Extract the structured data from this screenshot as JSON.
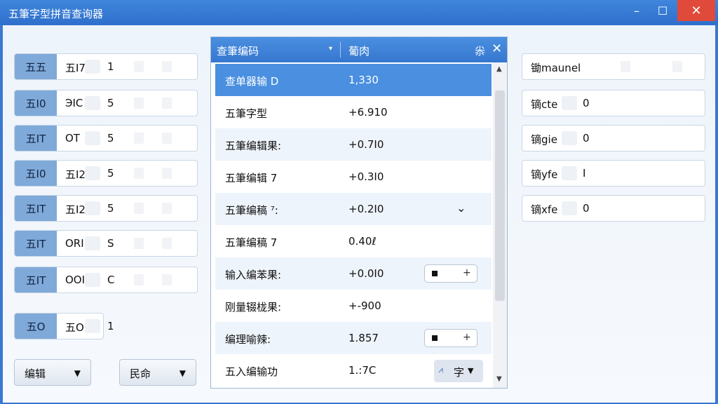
{
  "window": {
    "title": "五筆字型拼音查询器",
    "minimize": "–",
    "maximize": "☐",
    "close": "✕"
  },
  "left_rows": [
    {
      "tag": "五五",
      "code": "五I7",
      "value": "1"
    },
    {
      "tag": "五I0",
      "code": "ЭIC",
      "value": "5"
    },
    {
      "tag": "五IT",
      "code": "OT",
      "value": "5"
    },
    {
      "tag": "五I0",
      "code": "五I2",
      "value": "5"
    },
    {
      "tag": "五IT",
      "code": "五I2",
      "value": "5"
    },
    {
      "tag": "五IT",
      "code": "ORI",
      "value": "S"
    },
    {
      "tag": "五IT",
      "code": "OOIV",
      "value": "C"
    },
    {
      "tag": "五O",
      "code": "五OI",
      "value": "1"
    }
  ],
  "left_buttons": [
    {
      "label": "编辑",
      "arrow": "▼"
    },
    {
      "label": "民命",
      "arrow": "▼"
    }
  ],
  "grid": {
    "header_col1": "查筆编码",
    "header_col1_arrow": "▾",
    "header_col2": "葡肉",
    "header_icon": "尜",
    "header_close": "✕",
    "rows": [
      {
        "key": "查单器输 D",
        "value": "1,330",
        "selected": true
      },
      {
        "key": "五筆字型",
        "value": "+6.910",
        "alt": false
      },
      {
        "key": "五筆编辑果:",
        "value": "+0.7I0",
        "alt": true
      },
      {
        "key": "五筆编辑 7",
        "value": "+0.3I0",
        "alt": false
      },
      {
        "key": "五筆编稿 ⁷:",
        "value": "+0.2I0",
        "alt": true
      },
      {
        "key": "五筆编稿 7",
        "value": "0.40ℓ",
        "alt": false
      },
      {
        "key": "输入编苯果:",
        "value": "+0.0I0",
        "alt": true
      },
      {
        "key": "刚量辍栊果:",
        "value": "+-900",
        "alt": false
      },
      {
        "key": "编理喻辣:",
        "value": "1.857",
        "alt": true
      },
      {
        "key": "五入编输功",
        "value": "1.:7C",
        "alt": false
      }
    ],
    "chevron": "⌄",
    "stepper_plus": "+",
    "pinyin_label": "字",
    "pinyin_icon": "⩘",
    "pinyin_arrow": "▼",
    "scroll_up": "▲",
    "scroll_down": "▼"
  },
  "right_rows": [
    {
      "label": "锄mauneⅼ",
      "value": ""
    },
    {
      "label": "镝cte",
      "value": "0"
    },
    {
      "label": "镝gie",
      "value": "0"
    },
    {
      "label": "镝yfe",
      "value": "I"
    },
    {
      "label": "镝xfe",
      "value": "0"
    }
  ]
}
